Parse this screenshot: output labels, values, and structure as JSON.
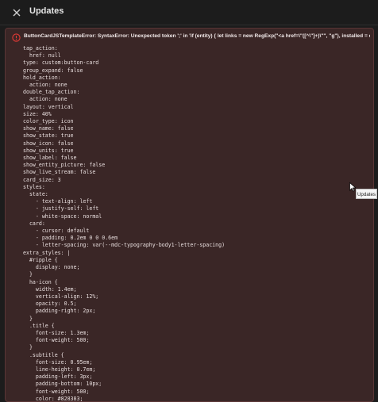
{
  "dialog": {
    "title": "Updates",
    "close_icon": "close-icon"
  },
  "error": {
    "icon": "error-icon",
    "message": "ButtonCardJSTemplateError: SyntaxError: Unexpected token ';' in 'if (entity) { let links = new RegExp(\"<a href=\\\"([^\\\"]+)\\\"\", \"g\"), installed = entity..."
  },
  "tooltip": {
    "text": "Updates"
  },
  "colors": {
    "card_background": "#3a2626",
    "card_border": "#5a3535",
    "error_icon": "#e53935",
    "page_background": "#1c1c1c"
  },
  "code_lines": [
    "tap_action:",
    "  href: null",
    "type: custom:button-card",
    "group_expand: false",
    "hold_action:",
    "  action: none",
    "double_tap_action:",
    "  action: none",
    "layout: vertical",
    "size: 40%",
    "color_type: icon",
    "show_name: false",
    "show_state: true",
    "show_icon: false",
    "show_units: true",
    "show_label: false",
    "show_entity_picture: false",
    "show_live_stream: false",
    "card_size: 3",
    "styles:",
    "  state:",
    "    - text-align: left",
    "    - justify-self: left",
    "    - white-space: normal",
    "  card:",
    "    - cursor: default",
    "    - padding: 0.2em 0 0 0.6em",
    "    - letter-spacing: var(--mdc-typography-body1-letter-spacing)",
    "extra_styles: |",
    "  #ripple {",
    "    display: none;",
    "  }",
    "  ha-icon {",
    "    width: 1.4em;",
    "    vertical-align: 12%;",
    "    opacity: 0.5;",
    "    padding-right: 2px;",
    "  }",
    "  .title {",
    "    font-size: 1.3em;",
    "    font-weight: 500;",
    "  }",
    "  .subtitle {",
    "    font-size: 0.95em;",
    "    line-height: 0.7em;",
    "    padding-left: 3px;",
    "    padding-bottom: 10px;",
    "    font-weight: 500;",
    "    color: #828383;",
    "  }"
  ]
}
